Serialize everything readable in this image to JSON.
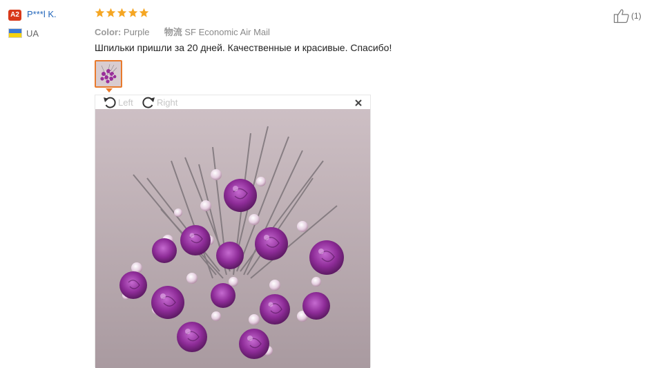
{
  "reviewer": {
    "level_badge": "A2",
    "name": "P***l K.",
    "country": "UA"
  },
  "rating": {
    "stars": 5,
    "max": 5,
    "color": "#f5a623"
  },
  "attributes": [
    {
      "key": "Color:",
      "value": "Purple"
    },
    {
      "key": "物流",
      "value": "SF Economic Air Mail"
    }
  ],
  "review_text": "Шпильки пришли за 20 дней. Качественные и красивые. Спасибо!",
  "helpful": {
    "count": "(1)",
    "icon": "thumbs-up-icon"
  },
  "viewer": {
    "rotate_left_label": "Left",
    "rotate_right_label": "Right",
    "close_icon": "close-icon"
  },
  "colors": {
    "accent": "#e87a2c",
    "link": "#2266bb",
    "badge": "#d8391a"
  }
}
